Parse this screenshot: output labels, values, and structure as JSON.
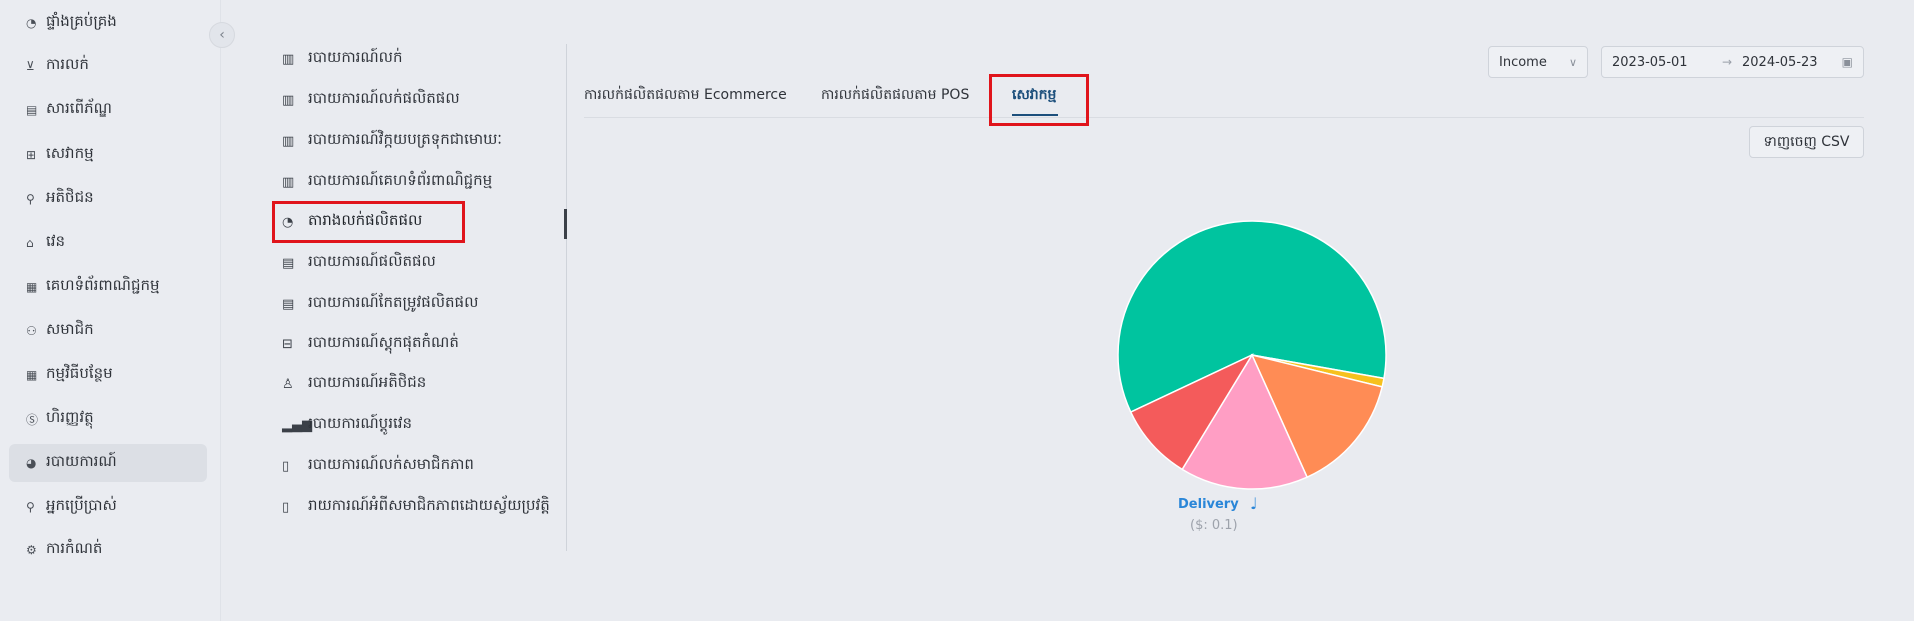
{
  "sidebar": {
    "items": [
      {
        "label": "ផ្ទាំងគ្រប់គ្រង",
        "icon": "dashboard-icon",
        "glyph": "◔"
      },
      {
        "label": "ការលក់",
        "icon": "cart-icon",
        "glyph": "⊻"
      },
      {
        "label": "សារពើភ័ណ្ឌ",
        "icon": "inventory-icon",
        "glyph": "▤"
      },
      {
        "label": "សេវាកម្ម",
        "icon": "grid-icon",
        "glyph": "⊞"
      },
      {
        "label": "អតិថិជន",
        "icon": "user-icon",
        "glyph": "⚲"
      },
      {
        "label": "វេន",
        "icon": "store-icon",
        "glyph": "⌂"
      },
      {
        "label": "គេហទំព័រពាណិជ្ជកម្ម",
        "icon": "web-store-icon",
        "glyph": "▦"
      },
      {
        "label": "សមាជិក",
        "icon": "members-icon",
        "glyph": "⚇"
      },
      {
        "label": "កម្មវិធីបន្ថែម",
        "icon": "addon-icon",
        "glyph": "▦"
      },
      {
        "label": "ហិរញ្ញវត្ថុ",
        "icon": "finance-icon",
        "glyph": "Ⓢ"
      },
      {
        "label": "របាយការណ៍",
        "icon": "report-icon",
        "glyph": "◕"
      },
      {
        "label": "អ្នកប្រើប្រាស់",
        "icon": "users-icon",
        "glyph": "⚲"
      },
      {
        "label": "ការកំណត់",
        "icon": "settings-icon",
        "glyph": "⚙"
      }
    ],
    "collapse_glyph": "‹"
  },
  "report_menu": {
    "items": [
      {
        "label": "របាយការណ៍លក់",
        "icon": "bar-report-icon",
        "glyph": "▥"
      },
      {
        "label": "របាយការណ៍លក់ផលិតផល",
        "icon": "bar-report-icon",
        "glyph": "▥"
      },
      {
        "label": "របាយការណ៍វិក្កយបត្រទុកជាមោឃៈ",
        "icon": "bar-report-icon",
        "glyph": "▥"
      },
      {
        "label": "របាយការណ៍គេហទំព័រពាណិជ្ជកម្ម",
        "icon": "bar-report-icon",
        "glyph": "▥"
      },
      {
        "label": "តារាងលក់ផលិតផល",
        "icon": "pie-chart-icon",
        "glyph": "◔"
      },
      {
        "label": "របាយការណ៍ផលិតផល",
        "icon": "product-report-icon",
        "glyph": "▤"
      },
      {
        "label": "របាយការណ៍កែតម្រូវផលិតផល",
        "icon": "product-report-icon",
        "glyph": "▤"
      },
      {
        "label": "របាយការណ៍ស្តុកផុតកំណត់",
        "icon": "minus-box-icon",
        "glyph": "⊟"
      },
      {
        "label": "របាយការណ៍អតិថិជន",
        "icon": "customer-icon",
        "glyph": "♙"
      },
      {
        "label": "របាយការណ៍ប្តូរវេន",
        "icon": "signal-bars-icon",
        "glyph": "▂▄▆"
      },
      {
        "label": "របាយការណ៍លក់សមាជិកភាព",
        "icon": "document-icon",
        "glyph": "▯"
      },
      {
        "label": "រាយការណ៍អំពីសមាជិកភាពដោយស្វ័យប្រវត្តិ",
        "icon": "document-icon",
        "glyph": "▯"
      }
    ]
  },
  "tabs": [
    {
      "label": "ការលក់ផលិតផលតាម Ecommerce"
    },
    {
      "label": "ការលក់ផលិតផលតាម POS"
    },
    {
      "label": "សេវាកម្ម"
    }
  ],
  "filters": {
    "type_value": "Income",
    "date_start": "2023-05-01",
    "date_end": "2024-05-23",
    "arrow": "→",
    "calendar_glyph": "▣",
    "chevron_glyph": "∨"
  },
  "export_label": "ទាញចេញ CSV",
  "chart_data": {
    "type": "pie",
    "slices": [
      {
        "name": "",
        "value": 0.58,
        "color": "#00c49f"
      },
      {
        "name": "",
        "value": 0.01,
        "color": "#f6c11d"
      },
      {
        "name": "",
        "value": 0.14,
        "color": "#ff8c55"
      },
      {
        "name": "",
        "value": 0.15,
        "color": "#ff9ec4"
      },
      {
        "name": "",
        "value": 0.09,
        "color": "#f45b5b"
      }
    ],
    "tooltip": {
      "label": "Delivery",
      "value": "($: 0.1)"
    }
  },
  "colors": {
    "accent": "#1c4f7c",
    "highlight": "#e0141b",
    "tooltip": "#2a86d8"
  }
}
